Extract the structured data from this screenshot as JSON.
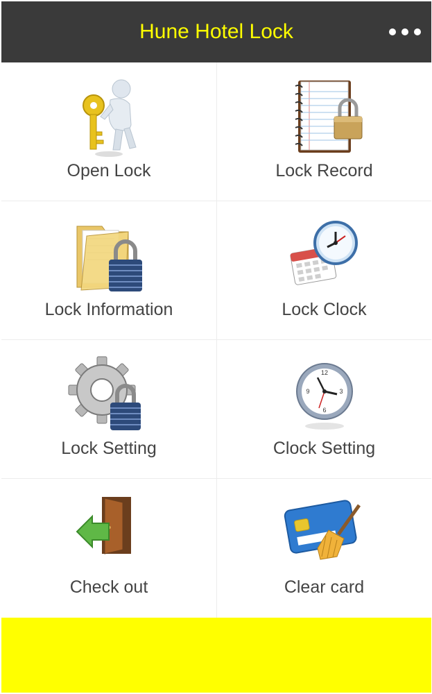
{
  "header": {
    "title": "Hune Hotel Lock",
    "more_icon": "more-dots-icon"
  },
  "menu": {
    "items": [
      {
        "label": "Open Lock",
        "icon": "key-person-icon"
      },
      {
        "label": "Lock Record",
        "icon": "notebook-padlock-icon"
      },
      {
        "label": "Lock Information",
        "icon": "folder-padlock-icon"
      },
      {
        "label": "Lock Clock",
        "icon": "calendar-clock-icon"
      },
      {
        "label": "Lock Setting",
        "icon": "gear-padlock-icon"
      },
      {
        "label": "Clock Setting",
        "icon": "clock-icon"
      },
      {
        "label": "Check out",
        "icon": "door-exit-icon"
      },
      {
        "label": "Clear card",
        "icon": "card-broom-icon"
      }
    ]
  },
  "colors": {
    "header_bg": "#3a3a3a",
    "header_title": "#ffff00",
    "footer_bar": "#ffff00",
    "label_text": "#444444"
  }
}
